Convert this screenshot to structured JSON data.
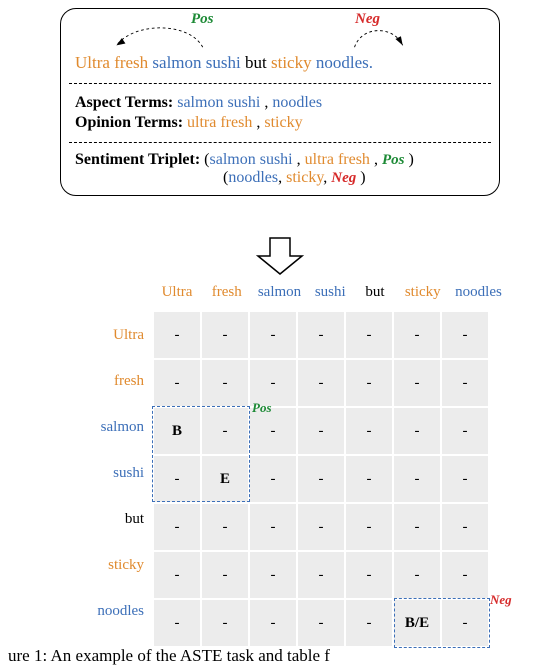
{
  "labels": {
    "pos": "Pos",
    "neg": "Neg"
  },
  "sentence": {
    "w1": "Ultra",
    "w2": "fresh",
    "w3": "salmon",
    "w4": "sushi",
    "w5": "but",
    "w6": "sticky",
    "w7": "noodles",
    "w7p": "noodles."
  },
  "box": {
    "aspect_label": "Aspect Terms:",
    "aspect_v1": "salmon sushi",
    "aspect_v2": "noodles",
    "opinion_label": "Opinion Terms:",
    "opinion_v1": "ultra fresh",
    "opinion_v2": "sticky",
    "triplet_label": "Sentiment Triplet:",
    "comma": " , ",
    "lparen": "(",
    "rparen": " )"
  },
  "grid": {
    "dash": "-",
    "B": "B",
    "E": "E",
    "BE": "B/E"
  },
  "caption": {
    "prefix": "ure 1:  An example of the ASTE task and table f"
  }
}
